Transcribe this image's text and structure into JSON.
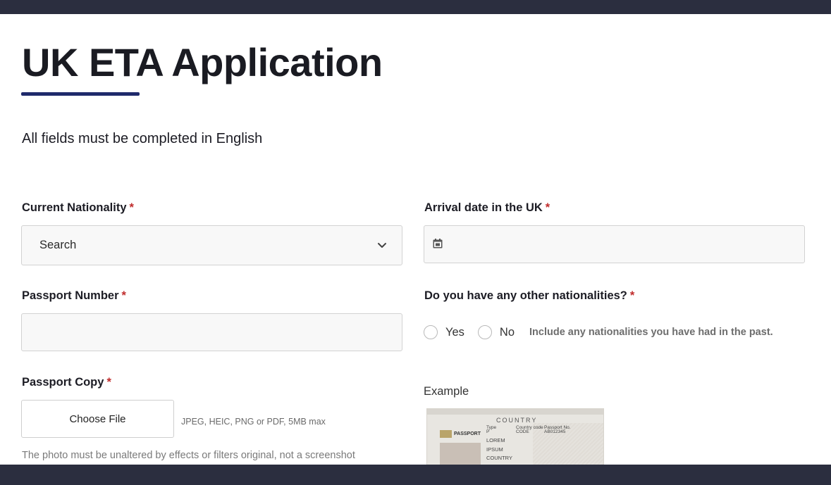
{
  "page": {
    "title": "UK ETA Application",
    "subtitle": "All fields must be completed in English",
    "required_marker": "*"
  },
  "form": {
    "nationality": {
      "label": "Current Nationality",
      "value": "Search"
    },
    "passport_number": {
      "label": "Passport Number",
      "value": ""
    },
    "passport_copy": {
      "label": "Passport Copy",
      "button_label": "Choose File",
      "accepted_hint": "JPEG, HEIC, PNG or PDF, 5MB max",
      "photo_note": "The photo must be unaltered by effects or filters original, not a screenshot"
    },
    "arrival_date": {
      "label": "Arrival date in the UK",
      "value": ""
    },
    "other_nationalities": {
      "label": "Do you have any other nationalities?",
      "options": [
        "Yes",
        "No"
      ],
      "hint": "Include any nationalities you have had in the past."
    },
    "example": {
      "label": "Example",
      "passport": {
        "country": "COUNTRY",
        "document_word": "PASSPORT",
        "type_label": "Type",
        "type_value": "P",
        "code_label": "Country code",
        "code_value": "CODE",
        "number_label": "Passport No.",
        "number_value": "AB012345",
        "surname_value": "LOREM",
        "given_value": "IPSUM",
        "nationality_value": "COUNTRY"
      }
    }
  },
  "colors": {
    "top_bar": "#2b2e3f",
    "accent": "#1f2a6b",
    "required": "#c02c2c"
  },
  "icons": {
    "nationality_dropdown": "chevron-down-icon",
    "arrival_date": "calendar-icon"
  }
}
